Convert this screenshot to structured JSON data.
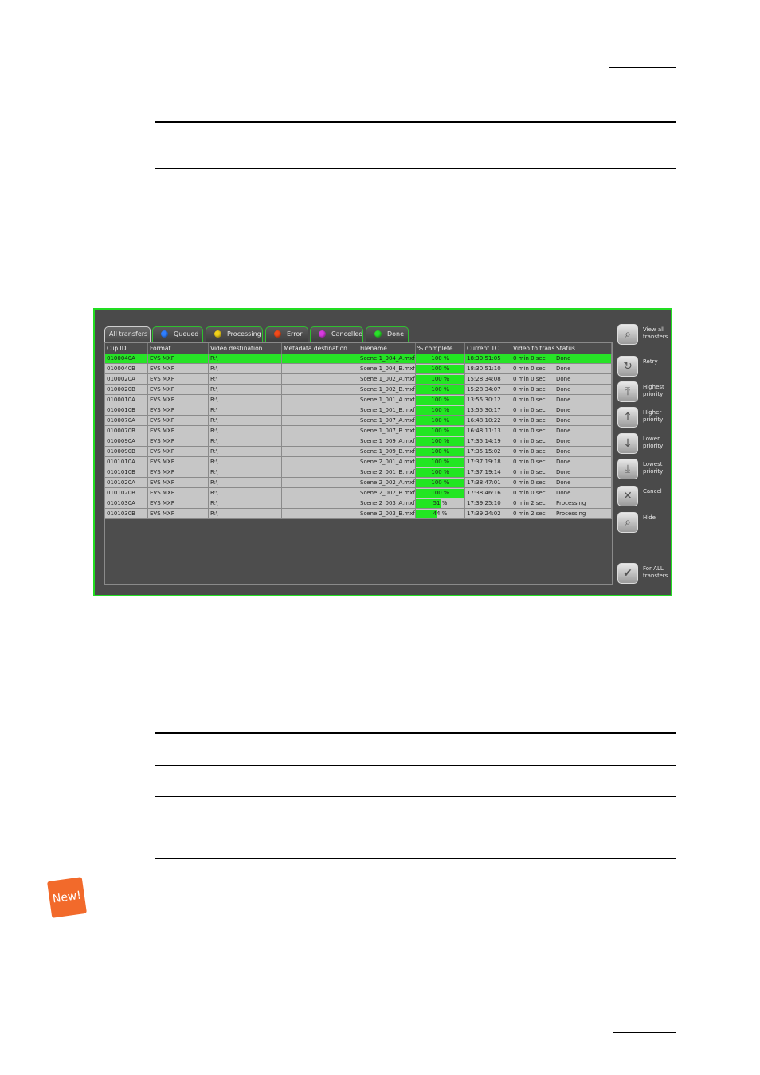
{
  "tabs": [
    {
      "label": "All transfers",
      "dot": null
    },
    {
      "label": "Queued",
      "dot": "#2f7fff"
    },
    {
      "label": "Processing",
      "dot": "#f2d21a"
    },
    {
      "label": "Error",
      "dot": "#f24a1a"
    },
    {
      "label": "Cancelled",
      "dot": "#d83ae0"
    },
    {
      "label": "Done",
      "dot": "#2ae22a"
    }
  ],
  "columns": [
    "Clip ID",
    "Format",
    "Video destination",
    "Metadata destination",
    "Filename",
    "% complete",
    "Current TC",
    "Video to transf",
    "Status"
  ],
  "rows": [
    {
      "clip_id": "0100040A",
      "format": "EVS MXF",
      "video_dest": "R:\\",
      "meta_dest": "",
      "filename": "Scene 1_004_A.mxf",
      "percent": 100,
      "percent_label": "100 %",
      "tc": "18:30:51:05",
      "video_to_transfer": "0 min 0 sec",
      "status": "Done",
      "selected": true
    },
    {
      "clip_id": "0100040B",
      "format": "EVS MXF",
      "video_dest": "R:\\",
      "meta_dest": "",
      "filename": "Scene 1_004_B.mxf",
      "percent": 100,
      "percent_label": "100 %",
      "tc": "18:30:51:10",
      "video_to_transfer": "0 min 0 sec",
      "status": "Done",
      "selected": false
    },
    {
      "clip_id": "0100020A",
      "format": "EVS MXF",
      "video_dest": "R:\\",
      "meta_dest": "",
      "filename": "Scene 1_002_A.mxf",
      "percent": 100,
      "percent_label": "100 %",
      "tc": "15:28:34:08",
      "video_to_transfer": "0 min 0 sec",
      "status": "Done",
      "selected": false
    },
    {
      "clip_id": "0100020B",
      "format": "EVS MXF",
      "video_dest": "R:\\",
      "meta_dest": "",
      "filename": "Scene 1_002_B.mxf",
      "percent": 100,
      "percent_label": "100 %",
      "tc": "15:28:34:07",
      "video_to_transfer": "0 min 0 sec",
      "status": "Done",
      "selected": false
    },
    {
      "clip_id": "0100010A",
      "format": "EVS MXF",
      "video_dest": "R:\\",
      "meta_dest": "",
      "filename": "Scene 1_001_A.mxf",
      "percent": 100,
      "percent_label": "100 %",
      "tc": "13:55:30:12",
      "video_to_transfer": "0 min 0 sec",
      "status": "Done",
      "selected": false
    },
    {
      "clip_id": "0100010B",
      "format": "EVS MXF",
      "video_dest": "R:\\",
      "meta_dest": "",
      "filename": "Scene 1_001_B.mxf",
      "percent": 100,
      "percent_label": "100 %",
      "tc": "13:55:30:17",
      "video_to_transfer": "0 min 0 sec",
      "status": "Done",
      "selected": false
    },
    {
      "clip_id": "0100070A",
      "format": "EVS MXF",
      "video_dest": "R:\\",
      "meta_dest": "",
      "filename": "Scene 1_007_A.mxf",
      "percent": 100,
      "percent_label": "100 %",
      "tc": "16:48:10:22",
      "video_to_transfer": "0 min 0 sec",
      "status": "Done",
      "selected": false
    },
    {
      "clip_id": "0100070B",
      "format": "EVS MXF",
      "video_dest": "R:\\",
      "meta_dest": "",
      "filename": "Scene 1_007_B.mxf",
      "percent": 100,
      "percent_label": "100 %",
      "tc": "16:48:11:13",
      "video_to_transfer": "0 min 0 sec",
      "status": "Done",
      "selected": false
    },
    {
      "clip_id": "0100090A",
      "format": "EVS MXF",
      "video_dest": "R:\\",
      "meta_dest": "",
      "filename": "Scene 1_009_A.mxf",
      "percent": 100,
      "percent_label": "100 %",
      "tc": "17:35:14:19",
      "video_to_transfer": "0 min 0 sec",
      "status": "Done",
      "selected": false
    },
    {
      "clip_id": "0100090B",
      "format": "EVS MXF",
      "video_dest": "R:\\",
      "meta_dest": "",
      "filename": "Scene 1_009_B.mxf",
      "percent": 100,
      "percent_label": "100 %",
      "tc": "17:35:15:02",
      "video_to_transfer": "0 min 0 sec",
      "status": "Done",
      "selected": false
    },
    {
      "clip_id": "0101010A",
      "format": "EVS MXF",
      "video_dest": "R:\\",
      "meta_dest": "",
      "filename": "Scene 2_001_A.mxf",
      "percent": 100,
      "percent_label": "100 %",
      "tc": "17:37:19:18",
      "video_to_transfer": "0 min 0 sec",
      "status": "Done",
      "selected": false
    },
    {
      "clip_id": "0101010B",
      "format": "EVS MXF",
      "video_dest": "R:\\",
      "meta_dest": "",
      "filename": "Scene 2_001_B.mxf",
      "percent": 100,
      "percent_label": "100 %",
      "tc": "17:37:19:14",
      "video_to_transfer": "0 min 0 sec",
      "status": "Done",
      "selected": false
    },
    {
      "clip_id": "0101020A",
      "format": "EVS MXF",
      "video_dest": "R:\\",
      "meta_dest": "",
      "filename": "Scene 2_002_A.mxf",
      "percent": 100,
      "percent_label": "100 %",
      "tc": "17:38:47:01",
      "video_to_transfer": "0 min 0 sec",
      "status": "Done",
      "selected": false
    },
    {
      "clip_id": "0101020B",
      "format": "EVS MXF",
      "video_dest": "R:\\",
      "meta_dest": "",
      "filename": "Scene 2_002_B.mxf",
      "percent": 100,
      "percent_label": "100 %",
      "tc": "17:38:46:16",
      "video_to_transfer": "0 min 0 sec",
      "status": "Done",
      "selected": false
    },
    {
      "clip_id": "0101030A",
      "format": "EVS MXF",
      "video_dest": "R:\\",
      "meta_dest": "",
      "filename": "Scene 2_003_A.mxf",
      "percent": 51,
      "percent_label": "51 %",
      "tc": "17:39:25:10",
      "video_to_transfer": "0 min 2 sec",
      "status": "Processing",
      "selected": false
    },
    {
      "clip_id": "0101030B",
      "format": "EVS MXF",
      "video_dest": "R:\\",
      "meta_dest": "",
      "filename": "Scene 2_003_B.mxf",
      "percent": 44,
      "percent_label": "44 %",
      "tc": "17:39:24:02",
      "video_to_transfer": "0 min 2 sec",
      "status": "Processing",
      "selected": false
    }
  ],
  "side_buttons": [
    {
      "label": "View all transfers",
      "icon": "magnifier-icon",
      "glyph": "⌕"
    },
    {
      "label": "Retry",
      "icon": "retry-icon",
      "glyph": "↻"
    },
    {
      "label": "Highest priority",
      "icon": "highest-priority-icon",
      "glyph": "⤒"
    },
    {
      "label": "Higher priority",
      "icon": "higher-priority-icon",
      "glyph": "↑"
    },
    {
      "label": "Lower priority",
      "icon": "lower-priority-icon",
      "glyph": "↓"
    },
    {
      "label": "Lowest priority",
      "icon": "lowest-priority-icon",
      "glyph": "⤓"
    },
    {
      "label": "Cancel",
      "icon": "cancel-icon",
      "glyph": "✕"
    },
    {
      "label": "Hide",
      "icon": "hide-icon",
      "glyph": "⌕"
    },
    {
      "label": "For ALL transfers",
      "icon": "check-icon",
      "glyph": "✔"
    }
  ],
  "new_badge": "New!"
}
